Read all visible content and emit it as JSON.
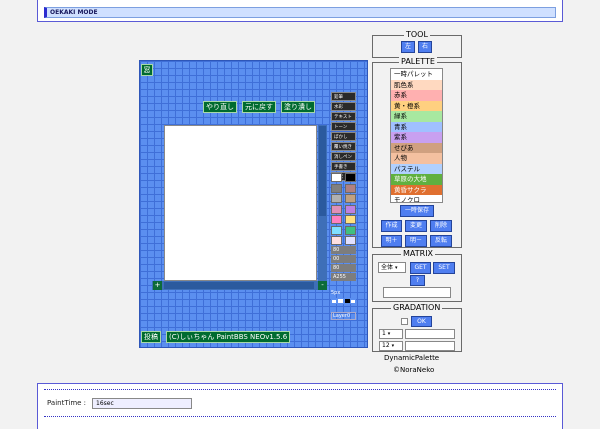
{
  "header": {
    "mode_title": "OEKAKI MODE"
  },
  "neo": {
    "window_button": "窓",
    "undo_label": "やり直し",
    "redo_label": "元に戻す",
    "fill_label": "塗り潰し",
    "post_label": "投稿",
    "credit": "(C)しぃちゃん PaintBBS NEOv1.5.6",
    "zoom_in": "+",
    "zoom_out": "-",
    "tools": [
      "鉛筆",
      "水彩",
      "テキスト",
      "トーン",
      "ぼかし",
      "覆い焼き",
      "消しペン",
      "手書き",
      "通常"
    ],
    "swatches_left": [
      "#ffffff",
      "#808080",
      "#b0b0b0",
      "#e090b8",
      "#ff80c0",
      "#80e0ff",
      "#ffe0e0"
    ],
    "swatches_right": [
      "#000000",
      "#b08080",
      "#c0a080",
      "#c080e0",
      "#ffe080",
      "#40c080",
      "#e0e0ff"
    ],
    "rgb": [
      "80",
      "00",
      "80",
      "A255"
    ],
    "px_label": "5px",
    "layer_label": "Layer0"
  },
  "tool": {
    "legend": "TOOL",
    "left_label": "左",
    "right_label": "右"
  },
  "palette": {
    "legend": "PALETTE",
    "items": [
      {
        "label": "一時パレット",
        "bg": "#ffffff",
        "fg": "#000000"
      },
      {
        "label": "肌色系",
        "bg": "#ffd9c0",
        "fg": "#000000"
      },
      {
        "label": "赤系",
        "bg": "#ffb0b0",
        "fg": "#000000"
      },
      {
        "label": "黄・橙系",
        "bg": "#ffd080",
        "fg": "#000000"
      },
      {
        "label": "緑系",
        "bg": "#a8e8a0",
        "fg": "#000000"
      },
      {
        "label": "青系",
        "bg": "#a0c0ff",
        "fg": "#000000"
      },
      {
        "label": "紫系",
        "bg": "#c8a0f0",
        "fg": "#000000"
      },
      {
        "label": "せぴあ",
        "bg": "#d0a080",
        "fg": "#000000"
      },
      {
        "label": "人物",
        "bg": "#f4c0a0",
        "fg": "#000000"
      },
      {
        "label": "パステル",
        "bg": "#b0d0ff",
        "fg": "#000000"
      },
      {
        "label": "草原の大地",
        "bg": "#60b040",
        "fg": "#ffffff"
      },
      {
        "label": "黄昏サクラ",
        "bg": "#e07030",
        "fg": "#ffffff"
      },
      {
        "label": "モノクロ",
        "bg": "#ffffff",
        "fg": "#000000"
      }
    ],
    "save_label": "一時保存",
    "create_label": "作成",
    "change_label": "変更",
    "delete_label": "削除",
    "brighter_label": "明＋",
    "darker_label": "明－",
    "invert_label": "反転"
  },
  "matrix": {
    "legend": "MATRIX",
    "select_value": "全体",
    "get_label": "GET",
    "set_label": "SET",
    "help_label": "?",
    "text_value": ""
  },
  "gradation": {
    "legend": "GRADATION",
    "ok_label": "OK",
    "select1_value": "1",
    "select2_value": "12"
  },
  "dynamic": {
    "title": "DynamicPalette",
    "copyright": "©NoraNeko"
  },
  "footer": {
    "paint_time_label": "PaintTime :",
    "paint_time_value": "16sec"
  }
}
